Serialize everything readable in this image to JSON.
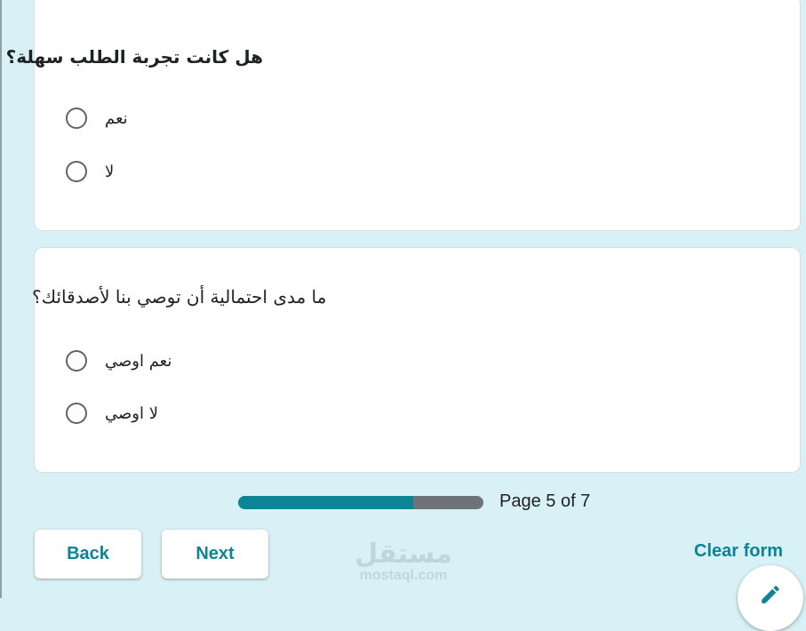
{
  "questions": [
    {
      "text": "هل كانت تجربة الطلب سهلة؟",
      "options": [
        "نعم",
        "لا"
      ]
    },
    {
      "text": "ما مدى احتمالية أن توصي بنا لأصدقائك؟",
      "options": [
        "نعم اوصي",
        "لا اوصي"
      ]
    }
  ],
  "progress": {
    "label": "Page 5 of 7",
    "current_page": 5,
    "total_pages": 7,
    "fill_fraction": 0.714
  },
  "nav": {
    "back_label": "Back",
    "next_label": "Next",
    "clear_label": "Clear form"
  },
  "watermark": {
    "main": "مستقل",
    "sub": "mostaql.com"
  },
  "colors": {
    "accent": "#0d8396",
    "background": "#d8f1f6",
    "track": "#6d7377"
  },
  "icons": {
    "fab": "pencil-icon"
  }
}
